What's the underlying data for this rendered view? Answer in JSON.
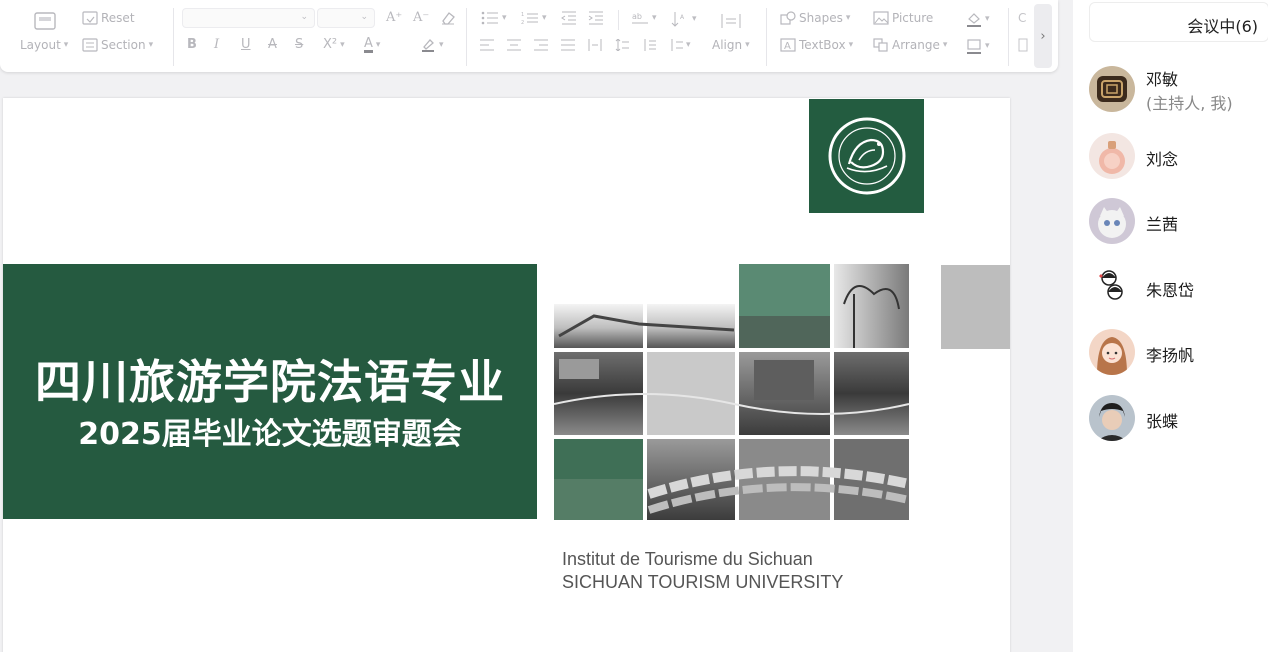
{
  "toolbar": {
    "reset": "Reset",
    "layout": "Layout",
    "section": "Section",
    "shapes": "Shapes",
    "picture": "Picture",
    "textbox": "TextBox",
    "arrange": "Arrange",
    "align": "Align",
    "bold": "B",
    "italic": "I",
    "underline": "U",
    "strike": "A",
    "strike2": "S",
    "superscript": "X²",
    "font_grow": "A⁺",
    "font_shrink": "A⁻",
    "font_color": "A"
  },
  "slide": {
    "title_main": "四川旅游学院法语专业",
    "title_sub": "2025届毕业论文选题审题会",
    "institute_fr": "Institut de Tourisme du Sichuan",
    "institute_en": "SICHUAN TOURISM UNIVERSITY"
  },
  "sidebar": {
    "status": "会议中(6)",
    "participants": [
      {
        "name": "邓敏",
        "role": "(主持人, 我)"
      },
      {
        "name": "刘念"
      },
      {
        "name": "兰茜"
      },
      {
        "name": "朱恩岱"
      },
      {
        "name": "李扬帆"
      },
      {
        "name": "张蝶"
      }
    ]
  },
  "colors": {
    "brand_green": "#255a40",
    "toolbar_icon": "#b3b3b8"
  }
}
